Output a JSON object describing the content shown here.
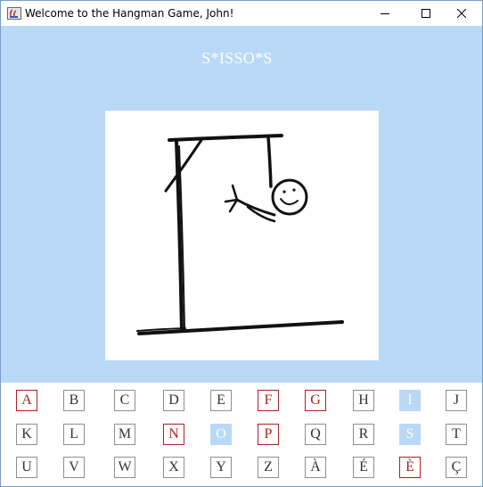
{
  "window": {
    "title": "Welcome to the Hangman Game, John!",
    "icon": "java-cup-icon",
    "controls": [
      "minimize-icon",
      "maximize-icon",
      "close-icon"
    ]
  },
  "game": {
    "masked_word": "S*ISSO*S",
    "drawing_stage": "head-and-arm"
  },
  "colors": {
    "background": "#b9d9f7",
    "wrong_letter": "#b01f22",
    "found_letter_bg": "#b9d9f7",
    "default_letter": "#333333"
  },
  "keyboard": {
    "rows": [
      [
        {
          "letter": "A",
          "state": "wrong"
        },
        {
          "letter": "B",
          "state": "default"
        },
        {
          "letter": "C",
          "state": "default"
        },
        {
          "letter": "D",
          "state": "default"
        },
        {
          "letter": "E",
          "state": "default"
        },
        {
          "letter": "F",
          "state": "wrong"
        },
        {
          "letter": "G",
          "state": "wrong"
        },
        {
          "letter": "H",
          "state": "default"
        },
        {
          "letter": "I",
          "state": "found"
        },
        {
          "letter": "J",
          "state": "default"
        }
      ],
      [
        {
          "letter": "K",
          "state": "default"
        },
        {
          "letter": "L",
          "state": "default"
        },
        {
          "letter": "M",
          "state": "default"
        },
        {
          "letter": "N",
          "state": "wrong"
        },
        {
          "letter": "O",
          "state": "found"
        },
        {
          "letter": "P",
          "state": "wrong"
        },
        {
          "letter": "Q",
          "state": "default"
        },
        {
          "letter": "R",
          "state": "default"
        },
        {
          "letter": "S",
          "state": "found"
        },
        {
          "letter": "T",
          "state": "default"
        }
      ],
      [
        {
          "letter": "U",
          "state": "default"
        },
        {
          "letter": "V",
          "state": "default"
        },
        {
          "letter": "W",
          "state": "default"
        },
        {
          "letter": "X",
          "state": "default"
        },
        {
          "letter": "Y",
          "state": "default"
        },
        {
          "letter": "Z",
          "state": "default"
        },
        {
          "letter": "À",
          "state": "default"
        },
        {
          "letter": "É",
          "state": "default"
        },
        {
          "letter": "È",
          "state": "wrong"
        },
        {
          "letter": "Ç",
          "state": "default"
        }
      ]
    ]
  }
}
